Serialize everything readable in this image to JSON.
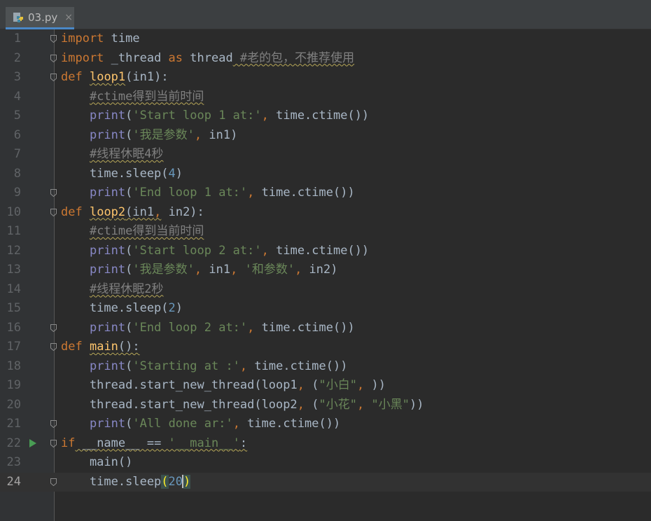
{
  "tab": {
    "filename": "03.py",
    "close": "×"
  },
  "lines": [
    {
      "n": "1",
      "tokens": [
        [
          "kw",
          "import"
        ],
        [
          "",
          " time"
        ]
      ]
    },
    {
      "n": "2",
      "tokens": [
        [
          "kw",
          "import"
        ],
        [
          "",
          " _thread "
        ],
        [
          "kw",
          "as"
        ],
        [
          "",
          " thread"
        ],
        [
          "cmt",
          " #老的包，不推荐使用"
        ]
      ]
    },
    {
      "n": "3",
      "tokens": [
        [
          "kw",
          "def"
        ],
        [
          "",
          " "
        ],
        [
          "fn",
          "loop1"
        ],
        [
          "",
          "(in1):"
        ]
      ]
    },
    {
      "n": "4",
      "tokens": [
        [
          "",
          "    "
        ],
        [
          "cmt",
          "#ctime得到当前时间"
        ]
      ]
    },
    {
      "n": "5",
      "tokens": [
        [
          "",
          "    "
        ],
        [
          "bi",
          "print"
        ],
        [
          "",
          "("
        ],
        [
          "str",
          "'Start loop 1 at:'"
        ],
        [
          "kw",
          ","
        ],
        [
          "",
          " time.ctime())"
        ]
      ]
    },
    {
      "n": "6",
      "tokens": [
        [
          "",
          "    "
        ],
        [
          "bi",
          "print"
        ],
        [
          "",
          "("
        ],
        [
          "str",
          "'我是参数'"
        ],
        [
          "kw",
          ","
        ],
        [
          "",
          " in1)"
        ]
      ]
    },
    {
      "n": "7",
      "tokens": [
        [
          "",
          "    "
        ],
        [
          "cmt",
          "#线程休眠4秒"
        ]
      ]
    },
    {
      "n": "8",
      "tokens": [
        [
          "",
          "    time.sleep("
        ],
        [
          "num",
          "4"
        ],
        [
          "",
          ")"
        ]
      ]
    },
    {
      "n": "9",
      "tokens": [
        [
          "",
          "    "
        ],
        [
          "bi",
          "print"
        ],
        [
          "",
          "("
        ],
        [
          "str",
          "'End loop 1 at:'"
        ],
        [
          "kw",
          ","
        ],
        [
          "",
          " time.ctime())"
        ]
      ]
    },
    {
      "n": "10",
      "tokens": [
        [
          "kw",
          "def"
        ],
        [
          "",
          " "
        ],
        [
          "fn",
          "loop2"
        ],
        [
          "",
          "(in1"
        ],
        [
          "kw",
          ","
        ],
        [
          "",
          " in2):"
        ]
      ]
    },
    {
      "n": "11",
      "tokens": [
        [
          "",
          "    "
        ],
        [
          "cmt",
          "#ctime得到当前时间"
        ]
      ]
    },
    {
      "n": "12",
      "tokens": [
        [
          "",
          "    "
        ],
        [
          "bi",
          "print"
        ],
        [
          "",
          "("
        ],
        [
          "str",
          "'Start loop 2 at:'"
        ],
        [
          "kw",
          ","
        ],
        [
          "",
          " time.ctime())"
        ]
      ]
    },
    {
      "n": "13",
      "tokens": [
        [
          "",
          "    "
        ],
        [
          "bi",
          "print"
        ],
        [
          "",
          "("
        ],
        [
          "str",
          "'我是参数'"
        ],
        [
          "kw",
          ","
        ],
        [
          "",
          " in1"
        ],
        [
          "kw",
          ","
        ],
        [
          "",
          " "
        ],
        [
          "str",
          "'和参数'"
        ],
        [
          "kw",
          ","
        ],
        [
          "",
          " in2)"
        ]
      ]
    },
    {
      "n": "14",
      "tokens": [
        [
          "",
          "    "
        ],
        [
          "cmt",
          "#线程休眠2秒"
        ]
      ]
    },
    {
      "n": "15",
      "tokens": [
        [
          "",
          "    time.sleep("
        ],
        [
          "num",
          "2"
        ],
        [
          "",
          ")"
        ]
      ]
    },
    {
      "n": "16",
      "tokens": [
        [
          "",
          "    "
        ],
        [
          "bi",
          "print"
        ],
        [
          "",
          "("
        ],
        [
          "str",
          "'End loop 2 at:'"
        ],
        [
          "kw",
          ","
        ],
        [
          "",
          " time.ctime())"
        ]
      ]
    },
    {
      "n": "17",
      "tokens": [
        [
          "kw",
          "def"
        ],
        [
          "",
          " "
        ],
        [
          "fn",
          "main"
        ],
        [
          "",
          "():"
        ]
      ]
    },
    {
      "n": "18",
      "tokens": [
        [
          "",
          "    "
        ],
        [
          "bi",
          "print"
        ],
        [
          "",
          "("
        ],
        [
          "str",
          "'Starting at :'"
        ],
        [
          "kw",
          ","
        ],
        [
          "",
          " time.ctime())"
        ]
      ]
    },
    {
      "n": "19",
      "tokens": [
        [
          "",
          "    thread.start_new_thread(loop1"
        ],
        [
          "kw",
          ","
        ],
        [
          "",
          " ("
        ],
        [
          "str",
          "\"小白\""
        ],
        [
          "kw",
          ","
        ],
        [
          "",
          " ))"
        ]
      ]
    },
    {
      "n": "20",
      "tokens": [
        [
          "",
          "    thread.start_new_thread(loop2"
        ],
        [
          "kw",
          ","
        ],
        [
          "",
          " ("
        ],
        [
          "str",
          "\"小花\""
        ],
        [
          "kw",
          ","
        ],
        [
          "",
          " "
        ],
        [
          "str",
          "\"小黑\""
        ],
        [
          "",
          "))"
        ]
      ]
    },
    {
      "n": "21",
      "tokens": [
        [
          "",
          "    "
        ],
        [
          "bi",
          "print"
        ],
        [
          "",
          "("
        ],
        [
          "str",
          "'All done ar:'"
        ],
        [
          "kw",
          ","
        ],
        [
          "",
          " time.ctime())"
        ]
      ]
    },
    {
      "n": "22",
      "tokens": [
        [
          "kw",
          "if"
        ],
        [
          "",
          " __name__ == "
        ],
        [
          "str",
          "'__main__'"
        ],
        [
          "",
          ":"
        ]
      ]
    },
    {
      "n": "23",
      "tokens": [
        [
          "",
          "    main()"
        ]
      ]
    },
    {
      "n": "24",
      "tokens": [
        [
          "",
          "    time.sleep"
        ],
        [
          "brace",
          "("
        ],
        [
          "num",
          "20"
        ],
        [
          "brace",
          ")"
        ]
      ]
    }
  ],
  "icons": {
    "tab": "python-file-icon",
    "run": "run-arrow-icon",
    "fold": "fold-marker-icon"
  },
  "colors": {
    "keyword": "#cc7832",
    "function": "#ffc66d",
    "string": "#6a8759",
    "comment": "#808080",
    "number": "#6897bb",
    "builtin": "#8888c6",
    "text": "#a9b7c6",
    "background": "#2b2b2b"
  }
}
